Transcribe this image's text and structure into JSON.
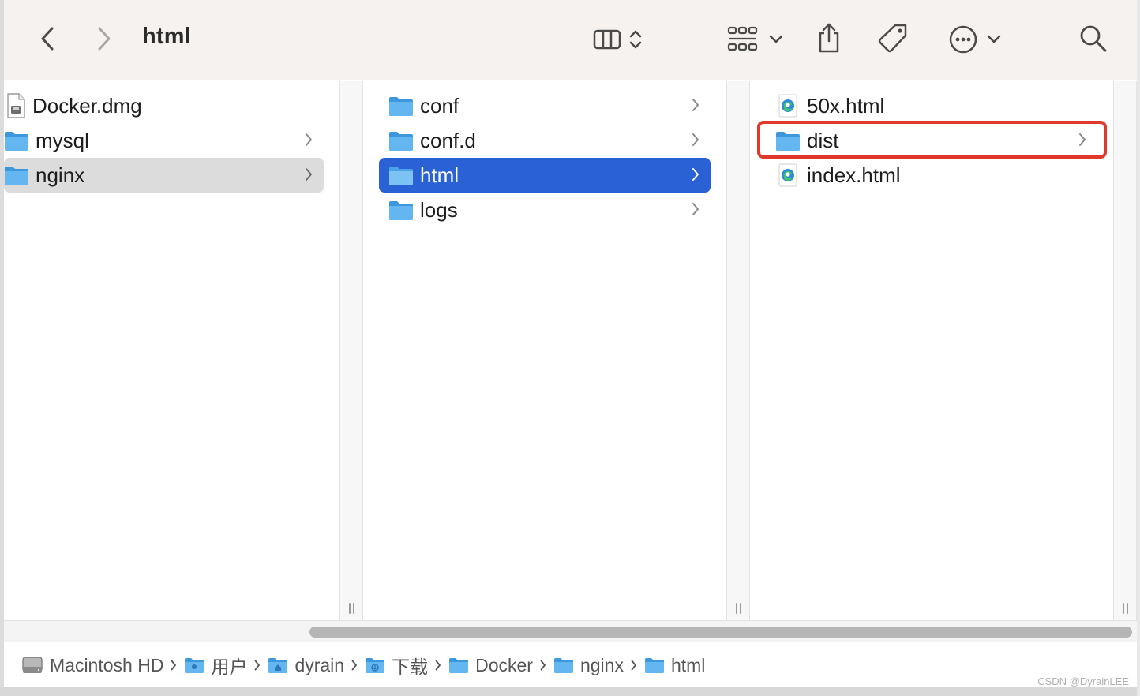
{
  "toolbar": {
    "title": "html",
    "buttons": {
      "back": "chevron-left-icon",
      "forward": "chevron-right-icon",
      "view": "column-view-icon",
      "group": "icon-grid-icon",
      "share": "share-icon",
      "tag": "tag-icon",
      "more": "ellipsis-circle-icon",
      "search": "search-icon"
    }
  },
  "columns": [
    {
      "items": [
        {
          "label": "Docker.dmg",
          "icon": "disk-image-icon",
          "has_children": false,
          "state": "normal"
        },
        {
          "label": "mysql",
          "icon": "folder-icon",
          "has_children": true,
          "state": "normal"
        },
        {
          "label": "nginx",
          "icon": "folder-icon",
          "has_children": true,
          "state": "selected-inactive"
        }
      ]
    },
    {
      "items": [
        {
          "label": "conf",
          "icon": "folder-icon",
          "has_children": true,
          "state": "normal"
        },
        {
          "label": "conf.d",
          "icon": "folder-icon",
          "has_children": true,
          "state": "normal"
        },
        {
          "label": "html",
          "icon": "folder-icon",
          "has_children": true,
          "state": "selected-active"
        },
        {
          "label": "logs",
          "icon": "folder-icon",
          "has_children": true,
          "state": "normal"
        }
      ]
    },
    {
      "items": [
        {
          "label": "50x.html",
          "icon": "edge-html-file-icon",
          "has_children": false,
          "state": "normal"
        },
        {
          "label": "dist",
          "icon": "folder-icon",
          "has_children": true,
          "state": "highlighted"
        },
        {
          "label": "index.html",
          "icon": "edge-html-file-icon",
          "has_children": false,
          "state": "normal"
        }
      ]
    }
  ],
  "pathbar": {
    "crumbs": [
      {
        "label": "Macintosh HD",
        "icon": "hard-drive-icon"
      },
      {
        "label": "用户",
        "icon": "users-folder-icon"
      },
      {
        "label": "dyrain",
        "icon": "home-folder-icon"
      },
      {
        "label": "下载",
        "icon": "downloads-folder-icon"
      },
      {
        "label": "Docker",
        "icon": "folder-icon"
      },
      {
        "label": "nginx",
        "icon": "folder-icon"
      },
      {
        "label": "html",
        "icon": "folder-icon"
      }
    ]
  },
  "watermark": "CSDN @DyrainLEE",
  "colors": {
    "selection_active": "#2a62d6",
    "selection_inactive": "#dcdcdc",
    "highlight_border": "#e0392b",
    "folder_blue": "#5fb1ec"
  }
}
